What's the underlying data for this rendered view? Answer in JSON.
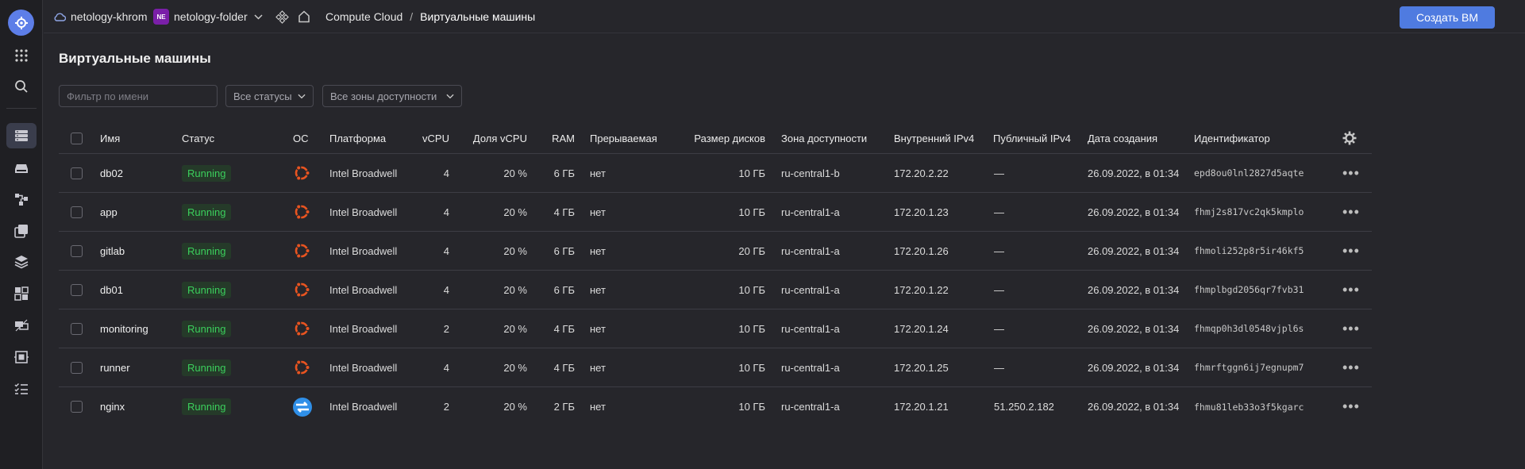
{
  "topbar": {
    "cloud": "netology-khrom",
    "folder_badge": "NE",
    "folder": "netology-folder",
    "service": "Compute Cloud",
    "separator": "/",
    "section": "Виртуальные машины",
    "create_button": "Создать ВМ"
  },
  "page": {
    "title": "Виртуальные машины",
    "filter_placeholder": "Фильтр по имени",
    "status_filter": "Все статусы",
    "zone_filter": "Все зоны доступности"
  },
  "table": {
    "headers": {
      "name": "Имя",
      "status": "Статус",
      "os": "ОС",
      "platform": "Платформа",
      "vcpu": "vCPU",
      "vcpu_share": "Доля vCPU",
      "ram": "RAM",
      "preemptible": "Прерываемая",
      "disk_size": "Размер дисков",
      "zone": "Зона доступности",
      "internal_ip": "Внутренний IPv4",
      "public_ip": "Публичный IPv4",
      "created": "Дата создания",
      "id": "Идентификатор"
    },
    "rows": [
      {
        "name": "db02",
        "status": "Running",
        "os": "ubuntu-icon",
        "platform": "Intel Broadwell",
        "vcpu": "4",
        "vcpu_share": "20 %",
        "ram": "6 ГБ",
        "preemptible": "нет",
        "disk": "10 ГБ",
        "zone": "ru-central1-b",
        "internal_ip": "172.20.2.22",
        "public_ip": "—",
        "created": "26.09.2022, в 01:34",
        "id": "epd8ou0lnl2827d5aqte"
      },
      {
        "name": "app",
        "status": "Running",
        "os": "ubuntu-icon",
        "platform": "Intel Broadwell",
        "vcpu": "4",
        "vcpu_share": "20 %",
        "ram": "4 ГБ",
        "preemptible": "нет",
        "disk": "10 ГБ",
        "zone": "ru-central1-a",
        "internal_ip": "172.20.1.23",
        "public_ip": "—",
        "created": "26.09.2022, в 01:34",
        "id": "fhmj2s817vc2qk5kmplo"
      },
      {
        "name": "gitlab",
        "status": "Running",
        "os": "ubuntu-icon",
        "platform": "Intel Broadwell",
        "vcpu": "4",
        "vcpu_share": "20 %",
        "ram": "6 ГБ",
        "preemptible": "нет",
        "disk": "20 ГБ",
        "zone": "ru-central1-a",
        "internal_ip": "172.20.1.26",
        "public_ip": "—",
        "created": "26.09.2022, в 01:34",
        "id": "fhmoli252p8r5ir46kf5"
      },
      {
        "name": "db01",
        "status": "Running",
        "os": "ubuntu-icon",
        "platform": "Intel Broadwell",
        "vcpu": "4",
        "vcpu_share": "20 %",
        "ram": "6 ГБ",
        "preemptible": "нет",
        "disk": "10 ГБ",
        "zone": "ru-central1-a",
        "internal_ip": "172.20.1.22",
        "public_ip": "—",
        "created": "26.09.2022, в 01:34",
        "id": "fhmplbgd2056qr7fvb31"
      },
      {
        "name": "monitoring",
        "status": "Running",
        "os": "ubuntu-icon",
        "platform": "Intel Broadwell",
        "vcpu": "2",
        "vcpu_share": "20 %",
        "ram": "4 ГБ",
        "preemptible": "нет",
        "disk": "10 ГБ",
        "zone": "ru-central1-a",
        "internal_ip": "172.20.1.24",
        "public_ip": "—",
        "created": "26.09.2022, в 01:34",
        "id": "fhmqp0h3dl0548vjpl6s"
      },
      {
        "name": "runner",
        "status": "Running",
        "os": "ubuntu-icon",
        "platform": "Intel Broadwell",
        "vcpu": "4",
        "vcpu_share": "20 %",
        "ram": "4 ГБ",
        "preemptible": "нет",
        "disk": "10 ГБ",
        "zone": "ru-central1-a",
        "internal_ip": "172.20.1.25",
        "public_ip": "—",
        "created": "26.09.2022, в 01:34",
        "id": "fhmrftggn6ij7egnupm7"
      },
      {
        "name": "nginx",
        "status": "Running",
        "os": "nat-instance-icon",
        "platform": "Intel Broadwell",
        "vcpu": "2",
        "vcpu_share": "20 %",
        "ram": "2 ГБ",
        "preemptible": "нет",
        "disk": "10 ГБ",
        "zone": "ru-central1-a",
        "internal_ip": "172.20.1.21",
        "public_ip": "51.250.2.182",
        "created": "26.09.2022, в 01:34",
        "id": "fhmu81leb33o3f5kgarc"
      }
    ]
  },
  "colors": {
    "accent": "#4f7be0",
    "status_running": "#3bcf5c",
    "ubuntu_orange": "#e95420",
    "nat_blue": "#2f8fe8"
  }
}
